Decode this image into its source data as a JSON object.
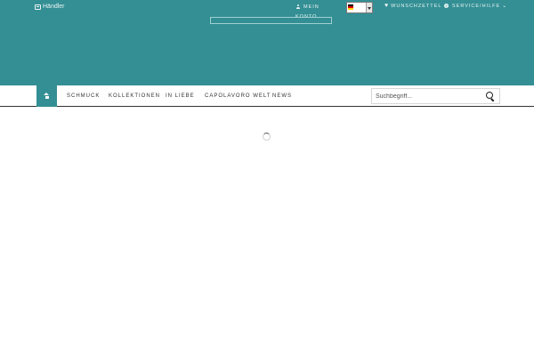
{
  "header": {
    "haendler_label": "Händler",
    "account_label": "MEIN KONTO",
    "language": {
      "selected": "DE",
      "flag_colors": [
        "#000000",
        "#dd0000",
        "#ffce00"
      ]
    },
    "wishlist_label": "WUNSCHZETTEL",
    "service_label": "SERVICE/HILFE",
    "brand_color": "#338f94"
  },
  "nav": {
    "home_icon": "home-icon",
    "items": [
      {
        "label": "SCHMUCK"
      },
      {
        "label": "KOLLEKTIONEN"
      },
      {
        "label": "IN LIEBE"
      },
      {
        "label": "CAPOLAVORO WELT"
      },
      {
        "label": "NEWS"
      }
    ],
    "search": {
      "placeholder": "Suchbegriff...",
      "value": ""
    }
  },
  "main": {
    "loading": true
  }
}
